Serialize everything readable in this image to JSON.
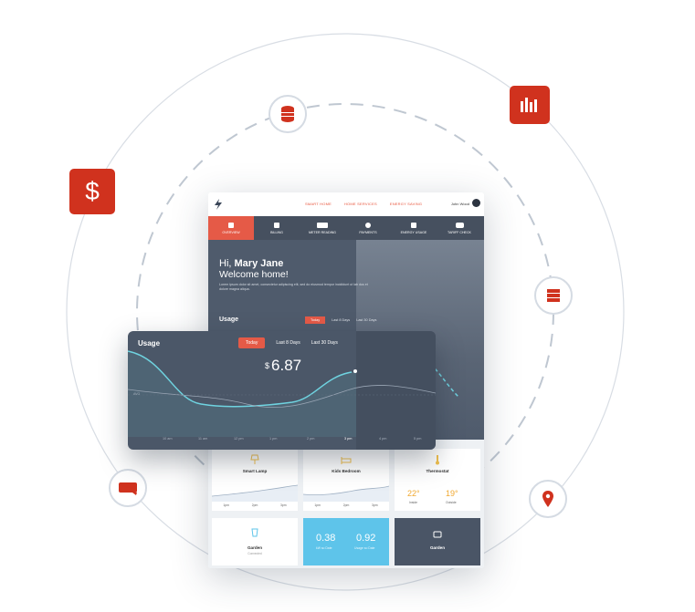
{
  "badges": {
    "dollar": "$"
  },
  "app": {
    "topnav": [
      "SMART HOME",
      "HOME SERVICES",
      "ENERGY SAVING"
    ],
    "user_name": "John Wood",
    "menu": [
      {
        "label": "OVERVIEW",
        "active": true
      },
      {
        "label": "BILLING",
        "active": false
      },
      {
        "label": "METER READING",
        "active": false
      },
      {
        "label": "PAYMENTS",
        "active": false
      },
      {
        "label": "ENERGY USAGE",
        "active": false
      },
      {
        "label": "TARIFF CHECK",
        "active": false
      }
    ],
    "greeting_prefix": "Hi,",
    "greeting_name": "Mary Jane",
    "greeting_line2": "Welcome home!",
    "lorem": "Lorem ipsum dolor sit amet, consectetur adipiscing elit, sed do eiusmod tempor incididunt ut lab dus et dolore magna aliqua.",
    "usage_label": "Usage",
    "usage_ranges": [
      "Today",
      "Last 8 Days",
      "Last 30 Days"
    ]
  },
  "usage_panel": {
    "title": "Usage",
    "ranges": [
      "Today",
      "Last 8 Days",
      "Last 30 Days"
    ],
    "active_range": "Today",
    "currency": "$",
    "value": "6.87",
    "y_label": "AVG",
    "x_ticks": [
      "10 am",
      "11 am",
      "12 pm",
      "1 pm",
      "2 pm",
      "3 pm",
      "4 pm",
      "5 pm",
      "6 pm"
    ]
  },
  "cards": {
    "smart_lamp": {
      "title": "Smart Lamp",
      "times": [
        "1pm",
        "2pm",
        "3pm"
      ]
    },
    "kids_bedroom": {
      "title": "Kids Bedroom",
      "times": [
        "1pm",
        "2pm",
        "3pm"
      ]
    },
    "thermostat": {
      "title": "Thermostat",
      "inside": "22°",
      "outside": "19°",
      "inside_label": "Inside",
      "outside_label": "Outside"
    },
    "garden": {
      "title": "Garden",
      "sub": "Connected"
    },
    "kwh_today": {
      "value": "0.38",
      "label": "kW so Date"
    },
    "kwh_usage": {
      "value": "0.92",
      "label": "Usage so Date"
    },
    "garden2": {
      "title": "Garden"
    }
  },
  "colors": {
    "accent": "#e55a47",
    "badge_red": "#d0321e",
    "panel": "#4b5768",
    "curve": "#6fd3e0",
    "blue_card": "#5ec4ea"
  }
}
